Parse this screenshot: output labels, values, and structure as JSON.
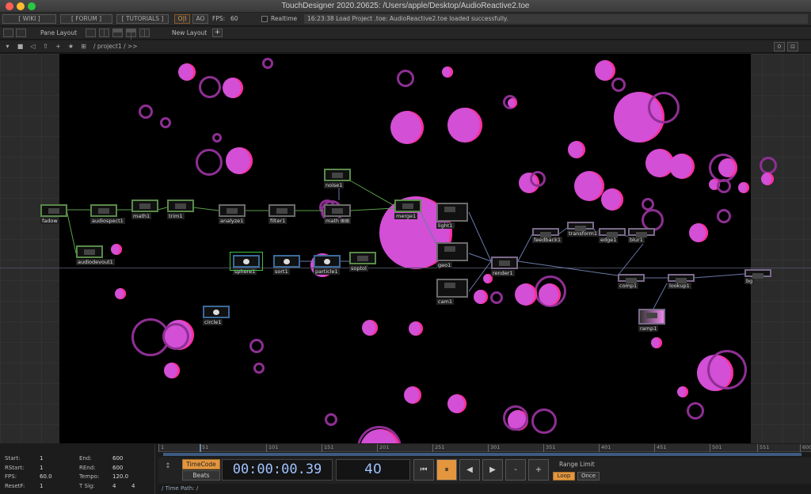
{
  "window": {
    "title": "TouchDesigner 2020.20625: /Users/apple/Desktop/AudioReactive2.toe"
  },
  "menu": {
    "wiki": "[ WIKI ]",
    "forum": "[ FORUM ]",
    "tutorials": "[ TUTORIALS ]",
    "oi": "O|I",
    "ao": "AO",
    "fps_label": "FPS:",
    "fps_value": "60",
    "realtime": "Realtime",
    "status": "16:23:38 Load Project .toe: AudioReactive2.toe loaded successfully."
  },
  "panebar": {
    "pane_layout": "Pane Layout",
    "new_layout": "New Layout",
    "add": "+"
  },
  "pathbar": {
    "path": "/ project1 / >>",
    "right_a": "0",
    "right_b": "⊡"
  },
  "nodes": [
    {
      "id": "fadow",
      "label": "fadow"
    },
    {
      "id": "audiospect1",
      "label": "audiospect1"
    },
    {
      "id": "math1",
      "label": "math1"
    },
    {
      "id": "trim1",
      "label": "trim1"
    },
    {
      "id": "analyze1",
      "label": "analyze1"
    },
    {
      "id": "filter1",
      "label": "filter1"
    },
    {
      "id": "noise1",
      "label": "noise1"
    },
    {
      "id": "math2",
      "label": "math ⊞⊞"
    },
    {
      "id": "merge1",
      "label": "merge1"
    },
    {
      "id": "audiodevout1",
      "label": "audiodevout1"
    },
    {
      "id": "sphere1",
      "label": "sphere1"
    },
    {
      "id": "sort1",
      "label": "sort1"
    },
    {
      "id": "particle1",
      "label": "particle1"
    },
    {
      "id": "soptol",
      "label": "soptol"
    },
    {
      "id": "light1",
      "label": "light1"
    },
    {
      "id": "geo1",
      "label": "geo1"
    },
    {
      "id": "cam1",
      "label": "cam1"
    },
    {
      "id": "render1",
      "label": "render1"
    },
    {
      "id": "feedback1",
      "label": "feedback1"
    },
    {
      "id": "transform1",
      "label": "transform1"
    },
    {
      "id": "edge1",
      "label": "edge1"
    },
    {
      "id": "blur1",
      "label": "blur1"
    },
    {
      "id": "comp1",
      "label": "comp1"
    },
    {
      "id": "lookup1",
      "label": "lookup1"
    },
    {
      "id": "bg",
      "label": "bg"
    },
    {
      "id": "ramp1",
      "label": "ramp1"
    },
    {
      "id": "circle1",
      "label": "circle1"
    }
  ],
  "timeline": {
    "ticks": [
      "1",
      "51",
      "101",
      "151",
      "201",
      "251",
      "301",
      "351",
      "401",
      "451",
      "501",
      "551",
      "600"
    ],
    "start_label": "Start:",
    "start": "1",
    "end_label": "End:",
    "end": "600",
    "rstart_label": "RStart:",
    "rstart": "1",
    "rend_label": "REnd:",
    "rend": "600",
    "fps_label": "FPS:",
    "fps": "60.0",
    "tempo_label": "Tempo:",
    "tempo": "120.0",
    "resetf_label": "ResetF:",
    "resetf": "1",
    "tsig_label": "T Sig:",
    "tsig_a": "4",
    "tsig_b": "4",
    "timecode_btn": "TimeCode",
    "beats_btn": "Beats",
    "timecode": "00:00:00.39",
    "frame": "40",
    "range_limit": "Range Limit",
    "loop": "Loop",
    "once": "Once",
    "time_path": "/  Time Path: /",
    "btn_start": "⏮",
    "btn_pause": "⏸",
    "btn_back": "◀",
    "btn_fwd": "▶",
    "btn_minus": "-",
    "btn_plus": "+",
    "side_tool": "↕"
  }
}
